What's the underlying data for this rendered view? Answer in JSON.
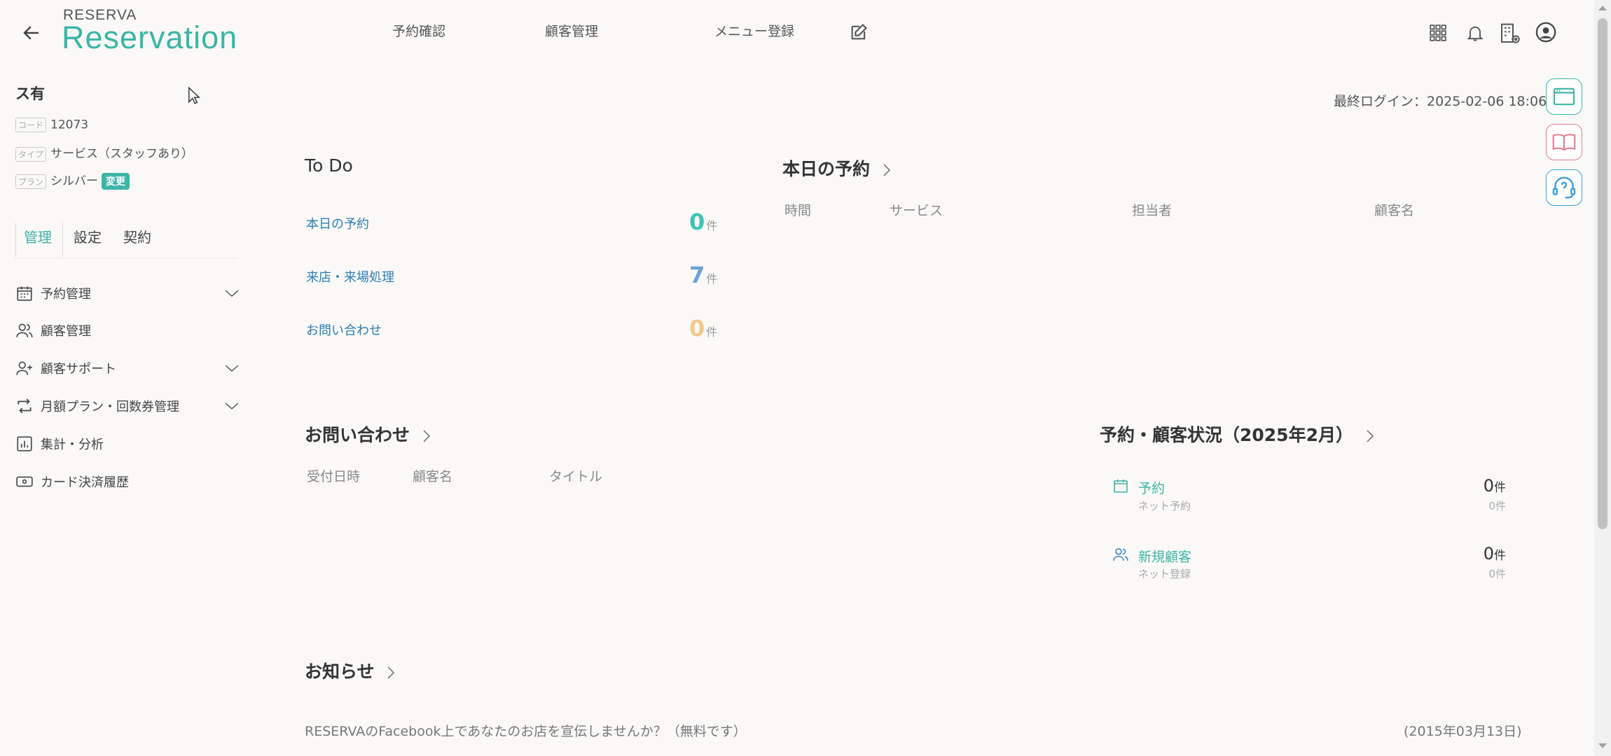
{
  "header": {
    "brand_small": "RESERVA",
    "brand_big": "Reservation",
    "nav": [
      "予約確認",
      "顧客管理",
      "メニュー登録"
    ],
    "icons": [
      "back-arrow-icon",
      "edit-icon",
      "apps-grid-icon",
      "bell-icon",
      "building-settings-icon",
      "user-account-icon"
    ]
  },
  "store": {
    "name": "ス有",
    "code_label": "コード",
    "code": "12073",
    "type_label": "タイプ",
    "type": "サービス（スタッフあり）",
    "plan_label": "プラン",
    "plan": "シルバー",
    "change_label": "変更"
  },
  "sidebar": {
    "tabs": [
      "管理",
      "設定",
      "契約"
    ],
    "active_tab": "管理",
    "items": [
      {
        "label": "予約管理",
        "icon": "calendar-icon",
        "expandable": true
      },
      {
        "label": "顧客管理",
        "icon": "users-icon",
        "expandable": false
      },
      {
        "label": "顧客サポート",
        "icon": "user-plus-icon",
        "expandable": true
      },
      {
        "label": "月額プラン・回数券管理",
        "icon": "repeat-icon",
        "expandable": true
      },
      {
        "label": "集計・分析",
        "icon": "bar-chart-icon",
        "expandable": false
      },
      {
        "label": "カード決済履歴",
        "icon": "card-icon",
        "expandable": false
      }
    ]
  },
  "last_login": "最終ログイン：2025-02-06 18:06",
  "todo": {
    "title": "To Do",
    "items": [
      {
        "label": "本日の予約",
        "count": "0",
        "unit": "件",
        "color": "#3cc4b4"
      },
      {
        "label": "来店・来場処理",
        "count": "7",
        "unit": "件",
        "color": "#6aa3d9"
      },
      {
        "label": "お問い合わせ",
        "count": "0",
        "unit": "件",
        "color": "#f2c98a"
      }
    ]
  },
  "today_reservations": {
    "title": "本日の予約",
    "columns": [
      "時間",
      "サービス",
      "担当者",
      "顧客名"
    ]
  },
  "inquiries": {
    "title": "お問い合わせ",
    "columns": [
      "受付日時",
      "顧客名",
      "タイトル"
    ]
  },
  "status": {
    "title": "予約・顧客状況（2025年2月）",
    "items": [
      {
        "title": "予約",
        "sub": "ネット予約",
        "count": "0",
        "unit": "件",
        "sub_count": "0件",
        "icon": "calendar-icon"
      },
      {
        "title": "新規顧客",
        "sub": "ネット登録",
        "count": "0",
        "unit": "件",
        "sub_count": "0件",
        "icon": "users-icon"
      }
    ]
  },
  "news": {
    "title": "お知らせ",
    "items": [
      {
        "text": "RESERVAのFacebook上であなたのお店を宣伝しませんか？（無料です）",
        "date": "(2015年03月13日)"
      }
    ]
  },
  "side_buttons": [
    {
      "icon": "browser-window-icon",
      "color": "#3cb5a6"
    },
    {
      "icon": "book-icon",
      "color": "#e57b8d"
    },
    {
      "icon": "headset-help-icon",
      "color": "#3a9fd8"
    }
  ],
  "colors": {
    "accent": "#3cb5a6",
    "link": "#2a7fb1"
  }
}
